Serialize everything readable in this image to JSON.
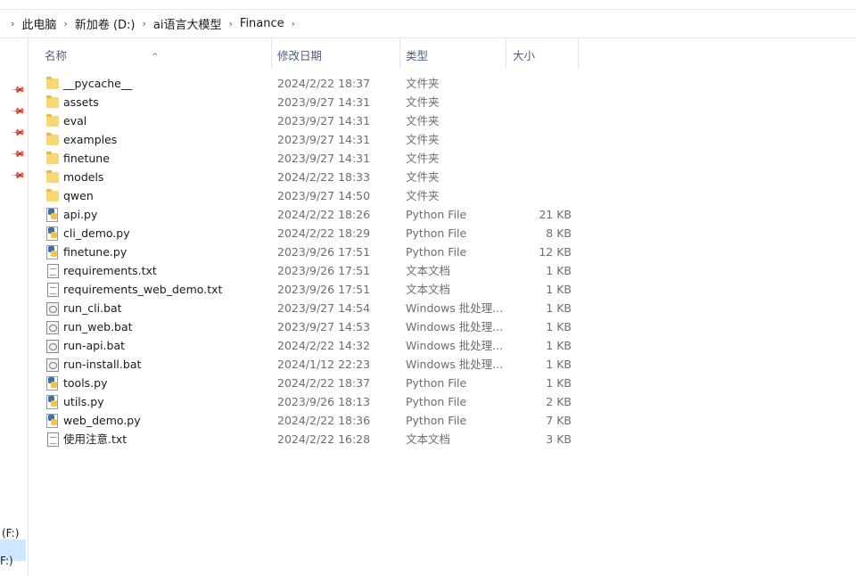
{
  "breadcrumb": [
    "此电脑",
    "新加卷 (D:)",
    "ai语言大模型",
    "Finance"
  ],
  "columns": {
    "name": "名称",
    "date": "修改日期",
    "type": "类型",
    "size": "大小"
  },
  "nav": {
    "drive_f1": "(F:)",
    "drive_f2": "F:)"
  },
  "files": [
    {
      "name": "__pycache__",
      "date": "2024/2/22 18:37",
      "type": "文件夹",
      "size": "",
      "icon": "folder-icon"
    },
    {
      "name": "assets",
      "date": "2023/9/27 14:31",
      "type": "文件夹",
      "size": "",
      "icon": "folder-icon"
    },
    {
      "name": "eval",
      "date": "2023/9/27 14:31",
      "type": "文件夹",
      "size": "",
      "icon": "folder-icon"
    },
    {
      "name": "examples",
      "date": "2023/9/27 14:31",
      "type": "文件夹",
      "size": "",
      "icon": "folder-icon"
    },
    {
      "name": "finetune",
      "date": "2023/9/27 14:31",
      "type": "文件夹",
      "size": "",
      "icon": "folder-icon"
    },
    {
      "name": "models",
      "date": "2024/2/22 18:33",
      "type": "文件夹",
      "size": "",
      "icon": "folder-icon"
    },
    {
      "name": "qwen",
      "date": "2023/9/27 14:50",
      "type": "文件夹",
      "size": "",
      "icon": "folder-icon"
    },
    {
      "name": "api.py",
      "date": "2024/2/22 18:26",
      "type": "Python File",
      "size": "21 KB",
      "icon": "python-file-icon"
    },
    {
      "name": "cli_demo.py",
      "date": "2024/2/22 18:29",
      "type": "Python File",
      "size": "8 KB",
      "icon": "python-file-icon"
    },
    {
      "name": "finetune.py",
      "date": "2023/9/26 17:51",
      "type": "Python File",
      "size": "12 KB",
      "icon": "python-file-icon"
    },
    {
      "name": "requirements.txt",
      "date": "2023/9/26 17:51",
      "type": "文本文档",
      "size": "1 KB",
      "icon": "text-file-icon"
    },
    {
      "name": "requirements_web_demo.txt",
      "date": "2023/9/26 17:51",
      "type": "文本文档",
      "size": "1 KB",
      "icon": "text-file-icon"
    },
    {
      "name": "run_cli.bat",
      "date": "2023/9/27 14:54",
      "type": "Windows 批处理...",
      "size": "1 KB",
      "icon": "batch-file-icon"
    },
    {
      "name": "run_web.bat",
      "date": "2023/9/27 14:53",
      "type": "Windows 批处理...",
      "size": "1 KB",
      "icon": "batch-file-icon"
    },
    {
      "name": "run-api.bat",
      "date": "2024/2/22 14:32",
      "type": "Windows 批处理...",
      "size": "1 KB",
      "icon": "batch-file-icon"
    },
    {
      "name": "run-install.bat",
      "date": "2024/1/12 22:23",
      "type": "Windows 批处理...",
      "size": "1 KB",
      "icon": "batch-file-icon"
    },
    {
      "name": "tools.py",
      "date": "2024/2/22 18:37",
      "type": "Python File",
      "size": "1 KB",
      "icon": "python-file-icon"
    },
    {
      "name": "utils.py",
      "date": "2023/9/26 18:13",
      "type": "Python File",
      "size": "2 KB",
      "icon": "python-file-icon"
    },
    {
      "name": "web_demo.py",
      "date": "2024/2/22 18:36",
      "type": "Python File",
      "size": "7 KB",
      "icon": "python-file-icon"
    },
    {
      "name": "使用注意.txt",
      "date": "2024/2/22 16:28",
      "type": "文本文档",
      "size": "3 KB",
      "icon": "text-file-icon"
    }
  ]
}
